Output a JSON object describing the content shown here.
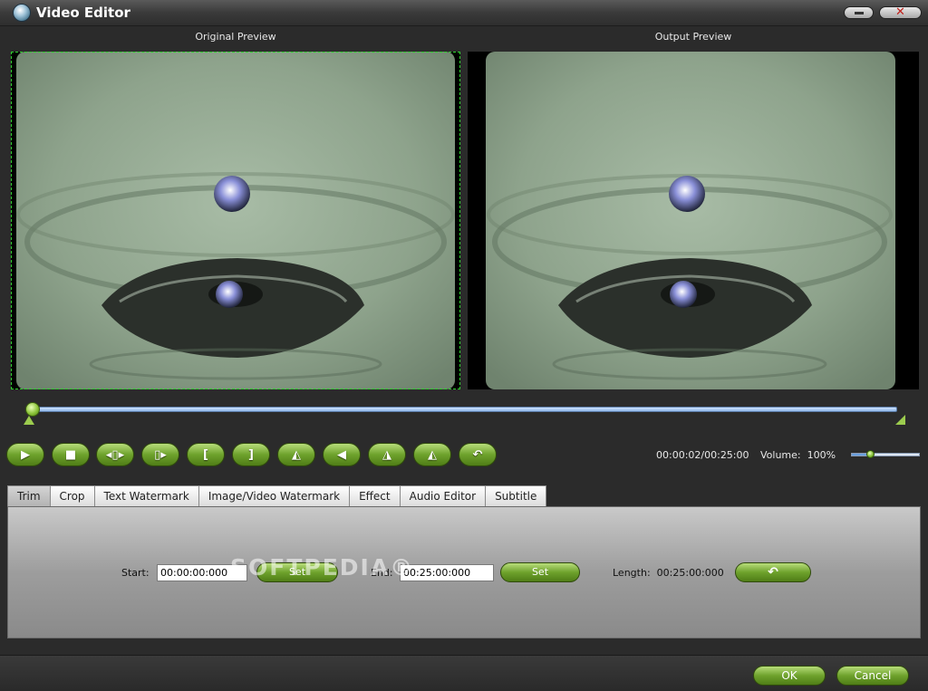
{
  "window": {
    "title": "Video Editor",
    "icon": "video-editor-app-icon"
  },
  "previews": {
    "original_label": "Original Preview",
    "output_label": "Output Preview"
  },
  "transport": {
    "buttons": [
      {
        "name": "play-button",
        "icon": "play-icon",
        "glyph": "▶"
      },
      {
        "name": "stop-button",
        "icon": "stop-icon",
        "glyph": "■"
      },
      {
        "name": "prev-frame-button",
        "icon": "step-back-icon",
        "glyph": "◂▯▸"
      },
      {
        "name": "next-frame-button",
        "icon": "step-forward-icon",
        "glyph": "▯▸"
      },
      {
        "name": "mark-in-button",
        "icon": "bracket-left-icon",
        "glyph": "["
      },
      {
        "name": "mark-out-button",
        "icon": "bracket-right-icon",
        "glyph": "]"
      },
      {
        "name": "flip-horizontal-button",
        "icon": "flip-horizontal-icon",
        "glyph": "◭"
      },
      {
        "name": "flip-vertical-button",
        "icon": "flip-vertical-icon",
        "glyph": "◀"
      },
      {
        "name": "rotate-left-button",
        "icon": "rotate-left-icon",
        "glyph": "◮"
      },
      {
        "name": "rotate-right-button",
        "icon": "rotate-right-icon",
        "glyph": "◭"
      },
      {
        "name": "undo-button",
        "icon": "undo-icon",
        "glyph": "↶"
      }
    ],
    "time": "00:00:02/00:25:00",
    "volume_label": "Volume:",
    "volume_value": "100%",
    "volume_level": 0.27
  },
  "timeline": {
    "position": 0.0
  },
  "tabs": [
    {
      "label": "Trim",
      "active": true
    },
    {
      "label": "Crop"
    },
    {
      "label": "Text Watermark"
    },
    {
      "label": "Image/Video Watermark"
    },
    {
      "label": "Effect"
    },
    {
      "label": "Audio Editor"
    },
    {
      "label": "Subtitle"
    }
  ],
  "trim": {
    "start_label": "Start:",
    "start_value": "00:00:00:000",
    "set_label": "Set",
    "end_label": "End:",
    "end_value": "00:25:00:000",
    "length_label": "Length:",
    "length_value": "00:25:00:000",
    "reset_icon": "reset-icon"
  },
  "watermark_text": "SOFTPEDIA®",
  "dialog": {
    "ok_label": "OK",
    "cancel_label": "Cancel"
  }
}
